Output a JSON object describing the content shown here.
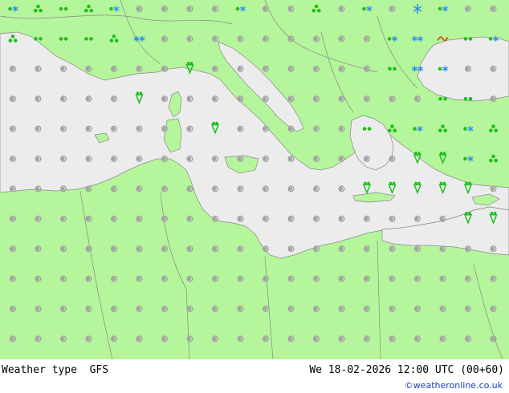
{
  "map": {
    "colors": {
      "land": "#b5f59b",
      "sea": "#ececec",
      "border": "#8a8a8a",
      "coast": "#8a8a8a",
      "dry": "#a3a3a3",
      "rain": "#1fbf1f",
      "snow": "#2f8ff0",
      "mixed": "#d06020"
    },
    "columns": 20,
    "rows": 12,
    "grid": [
      "sRrRsTTTTsTTRTsTFsTT",
      "RrrrRSTTTTTTTTTsSMrs",
      "TTTTTTTDTTTTTTTrSsTT",
      "TTTTTDTTTTTTTTTTTrrT",
      "TTTTTTTTDTTTTTrRsRsR",
      "TTTTTTTTTTTTTTTTDDsR",
      "TTTTTTTTTTTTTTDDDDDT",
      "TTTTTTTTTTTTTTTTTTDD",
      "TTTTTTTTTTTTTTTTTTTT",
      "TTTTTTTTTTTTTTTTTTTT",
      "TTTTTTTTTTTTTTTTTTTT",
      "TTTTTTTTTTTTTTTTTTTT"
    ],
    "legend_codes": {
      "T": "dry-open",
      "r": "light-rain",
      "R": "showers",
      "D": "thunderstorm",
      "s": "sleet",
      "S": "snow",
      "F": "snow-shower",
      "M": "mixed"
    }
  },
  "footer": {
    "title": "Weather type  GFS",
    "datetime": "We 18-02-2026 12:00 UTC (00+60)",
    "credit": "©weatheronline.co.uk"
  }
}
